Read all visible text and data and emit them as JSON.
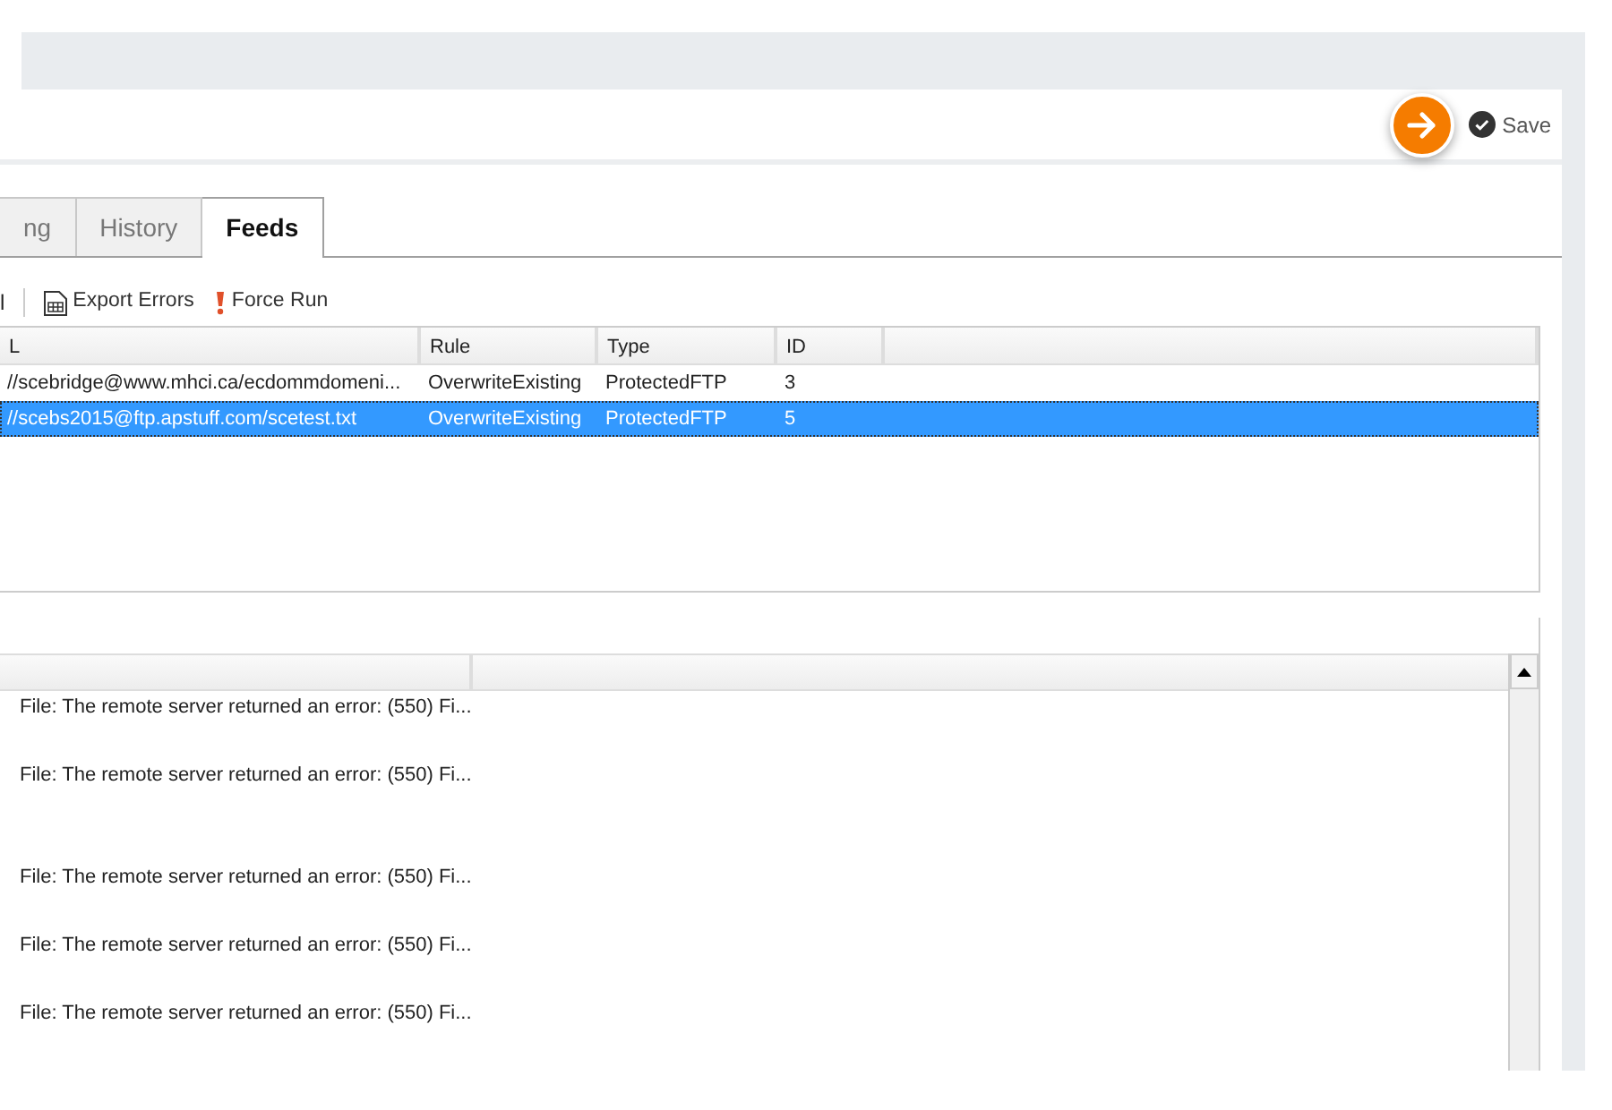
{
  "header": {
    "save_label": "Save"
  },
  "tabs": [
    {
      "label": "ng",
      "selected": false
    },
    {
      "label": "History",
      "selected": false
    },
    {
      "label": "Feeds",
      "selected": true
    }
  ],
  "toolbar": {
    "cut_item": "l",
    "items": [
      {
        "kind": "export",
        "label": "Export Errors"
      },
      {
        "kind": "force",
        "label": "Force Run"
      }
    ]
  },
  "feeds_table": {
    "columns": [
      "L",
      "Rule",
      "Type",
      "ID"
    ],
    "rows": [
      {
        "cells": [
          "//scebridge@www.mhci.ca/ecdommdomeni...",
          "OverwriteExisting",
          "ProtectedFTP",
          "3"
        ],
        "selected": false
      },
      {
        "cells": [
          "//scebs2015@ftp.apstuff.com/scetest.txt",
          "OverwriteExisting",
          "ProtectedFTP",
          "5"
        ],
        "selected": true
      }
    ]
  },
  "log_table": {
    "rows": [
      "File: The remote server returned an error: (550) Fi...",
      "File: The remote server returned an error: (550) Fi...",
      "File: The remote server returned an error: (550) Fi...",
      "File: The remote server returned an error: (550) Fi...",
      "File: The remote server returned an error: (550) Fi..."
    ]
  }
}
